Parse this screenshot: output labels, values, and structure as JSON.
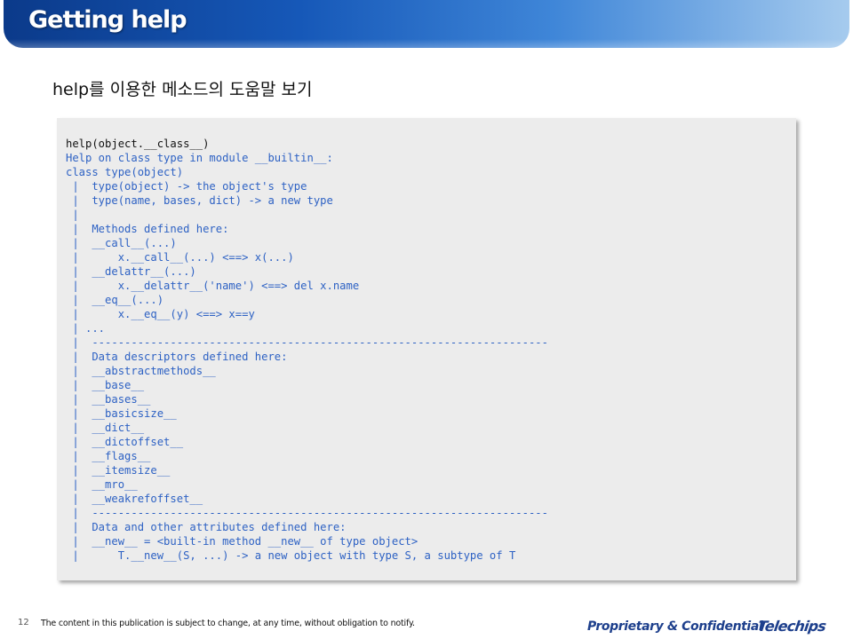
{
  "header": {
    "title": "Getting help"
  },
  "subtitle": "help를 이용한 메소드의 도움말 보기",
  "code": {
    "lines": [
      "help(object.__class__)",
      "Help on class type in module __builtin__:",
      "class type(object)",
      " |  type(object) -> the object's type",
      " |  type(name, bases, dict) -> a new type",
      " |",
      " |  Methods defined here:",
      " |  __call__(...)",
      " |      x.__call__(...) <==> x(...)",
      " |  __delattr__(...)",
      " |      x.__delattr__('name') <==> del x.name",
      " |  __eq__(...)",
      " |      x.__eq__(y) <==> x==y",
      " | ...",
      " |  ----------------------------------------------------------------------",
      " |  Data descriptors defined here:",
      " |  __abstractmethods__",
      " |  __base__",
      " |  __bases__",
      " |  __basicsize__",
      " |  __dict__",
      " |  __dictoffset__",
      " |  __flags__",
      " |  __itemsize__",
      " |  __mro__",
      " |  __weakrefoffset__",
      " |  ----------------------------------------------------------------------",
      " |  Data and other attributes defined here:",
      " |  __new__ = <built-in method __new__ of type object>",
      " |      T.__new__(S, ...) -> a new object with type S, a subtype of T"
    ]
  },
  "footer": {
    "page_number": "12",
    "disclaimer": "The content in this publication is subject to change, at any time, without obligation to notify.",
    "confidential": "Proprietary & Confidential",
    "logo_text": "Telechips"
  },
  "colors": {
    "title_bar_dark": "#0b3a8a",
    "title_bar_light": "#a6cbee",
    "code_text": "#2e62c4",
    "code_background": "#ececec",
    "footer_brand": "#1d3f8c"
  }
}
